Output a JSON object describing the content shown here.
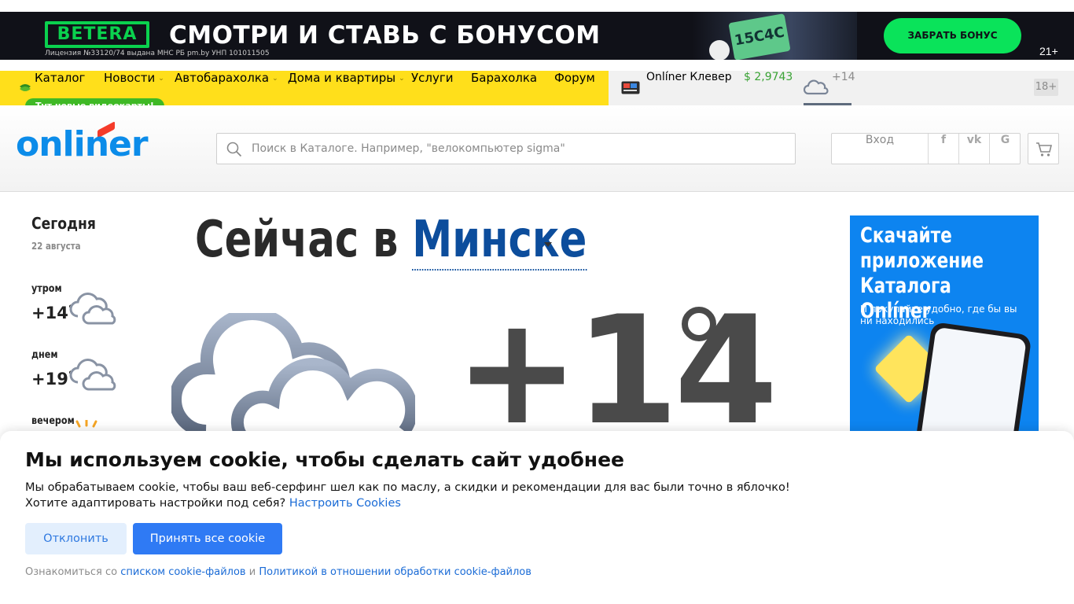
{
  "banner": {
    "brand": "BETERA",
    "headline": "СМОТРИ И СТАВЬ С БОНУСОМ",
    "license": "Лицензия №33120/74 выдана МНС РБ pm.by УНП 101011505",
    "promo_art": "15С4С",
    "cta": "ЗАБРАТЬ БОНУС",
    "age": "21+"
  },
  "nav": {
    "items": [
      {
        "label": "Каталог"
      },
      {
        "label": "Новости"
      },
      {
        "label": "Автобарахолка"
      },
      {
        "label": "Дома и квартиры"
      },
      {
        "label": "Услуги"
      },
      {
        "label": "Барахолка"
      },
      {
        "label": "Форум"
      }
    ],
    "badge": "Тут новые видеокарты!",
    "clever": "Onlíner Клевер",
    "currency": "$ 2,9743",
    "weather_temp": "+14",
    "age": "18+"
  },
  "header": {
    "logo": "onliner",
    "search_placeholder": "Поиск в Каталоге. Например, \"велокомпьютер sigma\"",
    "login": "Вход",
    "social": [
      "f",
      "vk",
      "G"
    ]
  },
  "today": {
    "title": "Сегодня",
    "date": "22 августа",
    "parts": [
      {
        "label": "утром",
        "temp": "+14",
        "deg": "°",
        "icon": "cloudy-icon"
      },
      {
        "label": "днем",
        "temp": "+19",
        "deg": "°",
        "icon": "cloudy-icon"
      },
      {
        "label": "вечером",
        "icon": "sun-icon"
      }
    ]
  },
  "now": {
    "prefix": "Сейчас в",
    "city": "Минске",
    "temp": "+14",
    "icon": "cloudy-icon"
  },
  "ad": {
    "title": "Скачайте приложение Каталога Onlíner",
    "subtitle": "И покупайте удобно, где бы вы ни находились"
  },
  "cookie": {
    "title": "Мы используем cookie, чтобы сделать сайт удобнее",
    "text1": "Мы обрабатываем cookie, чтобы ваш веб-серфинг шел как по маслу, а скидки и рекомендации для вас были точно в яблочко!",
    "text2": "Хотите адаптировать настройки под себя?",
    "settings_link": "Настроить Cookies",
    "decline": "Отклонить",
    "accept": "Принять все cookie",
    "foot_prefix": "Ознакомиться со",
    "foot_link1": "списком cookie-файлов",
    "foot_and": "и",
    "foot_link2": "Политикой в отношении обработки cookie-файлов"
  },
  "colors": {
    "nav_yellow": "#ffdf1b",
    "brand_blue": "#0c8ce9",
    "city_blue": "#0c4d9c",
    "accept_blue": "#2f7af4",
    "currency_green": "#3aa335",
    "badge_green": "#3fb925"
  }
}
